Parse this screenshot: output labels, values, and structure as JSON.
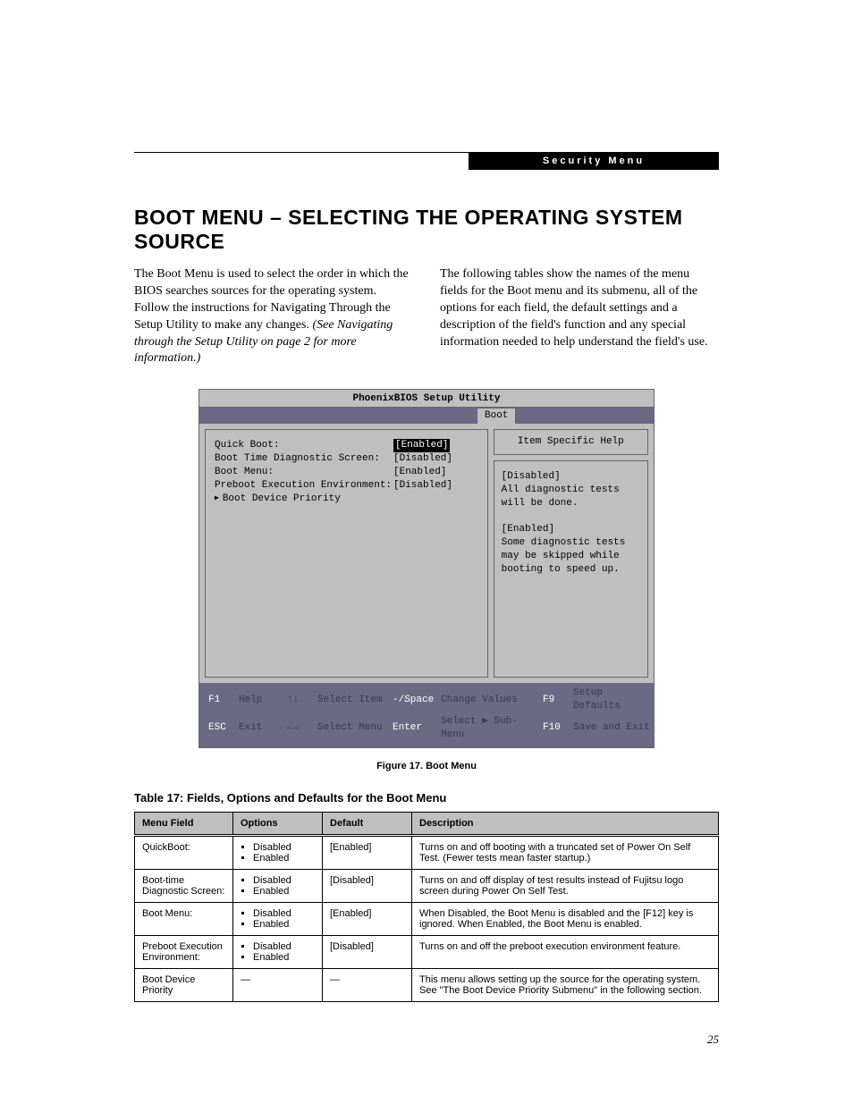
{
  "header": {
    "section_label": "Security Menu"
  },
  "title": "BOOT MENU – SELECTING THE OPERATING SYSTEM SOURCE",
  "intro": {
    "left": "The Boot Menu is used to select the order in which the BIOS searches sources for the operating system. Follow the instructions for Navigating Through the Setup Utility to make any changes. ",
    "left_italic": "(See Navigating through the Setup Utility on page 2 for more information.)",
    "right": "The following tables show the names of the menu fields for the Boot menu and its submenu, all of the options for each field, the default settings and a description of the field's function and any special information needed to help understand the field's use."
  },
  "bios": {
    "title": "PhoenixBIOS Setup Utility",
    "tab": "Boot",
    "rows": [
      {
        "label": "Quick Boot:",
        "value": "[Enabled]",
        "selected": true
      },
      {
        "label": "Boot Time Diagnostic Screen:",
        "value": "[Disabled]",
        "selected": false
      },
      {
        "label": "Boot Menu:",
        "value": "[Enabled]",
        "selected": false
      },
      {
        "label": "Preboot Execution Environment:",
        "value": "[Disabled]",
        "selected": false
      }
    ],
    "submenu": "Boot Device Priority",
    "help_title": "Item Specific Help",
    "help_body1_head": "[Disabled]",
    "help_body1": "All diagnostic tests will be done.",
    "help_body2_head": "[Enabled]",
    "help_body2": "Some diagnostic tests may be skipped while booting to speed up.",
    "footer": {
      "f1": "F1",
      "f1_label": "Help",
      "updown": "↑↓",
      "updown_label": "Select Item",
      "minus": "-/Space",
      "minus_label": "Change Values",
      "f9": "F9",
      "f9_label": "Setup Defaults",
      "esc": "ESC",
      "esc_label": "Exit",
      "leftright": "←→",
      "leftright_label": "Select Menu",
      "enter": "Enter",
      "enter_label": "Select ▶ Sub-Menu",
      "f10": "F10",
      "f10_label": "Save and Exit"
    }
  },
  "figure_caption": "Figure 17.  Boot Menu",
  "table_caption": "Table 17: Fields, Options and Defaults for the Boot Menu",
  "table": {
    "headers": [
      "Menu Field",
      "Options",
      "Default",
      "Description"
    ],
    "rows": [
      {
        "field": "QuickBoot:",
        "options": [
          "Disabled",
          "Enabled"
        ],
        "default": "[Enabled]",
        "desc": "Turns on and off booting with a truncated set of Power On Self Test. (Fewer tests mean faster startup.)"
      },
      {
        "field": "Boot-time Diagnostic Screen:",
        "options": [
          "Disabled",
          "Enabled"
        ],
        "default": "[Disabled]",
        "desc": "Turns on and off display of test results instead of Fujitsu logo screen during Power On Self Test."
      },
      {
        "field": "Boot Menu:",
        "options": [
          "Disabled",
          "Enabled"
        ],
        "default": "[Enabled]",
        "desc": "When Disabled, the Boot Menu is disabled and the [F12] key is ignored. When Enabled, the Boot Menu is enabled."
      },
      {
        "field": "Preboot Execution Environment:",
        "options": [
          "Disabled",
          "Enabled"
        ],
        "default": "[Disabled]",
        "desc": "Turns on and off the preboot execution environment feature."
      },
      {
        "field": "Boot Device Priority",
        "options": [],
        "default": "—",
        "desc": "This menu allows setting up the source for the operating system. See \"The Boot Device Priority Submenu\" in the following section."
      }
    ]
  },
  "page_number": "25"
}
